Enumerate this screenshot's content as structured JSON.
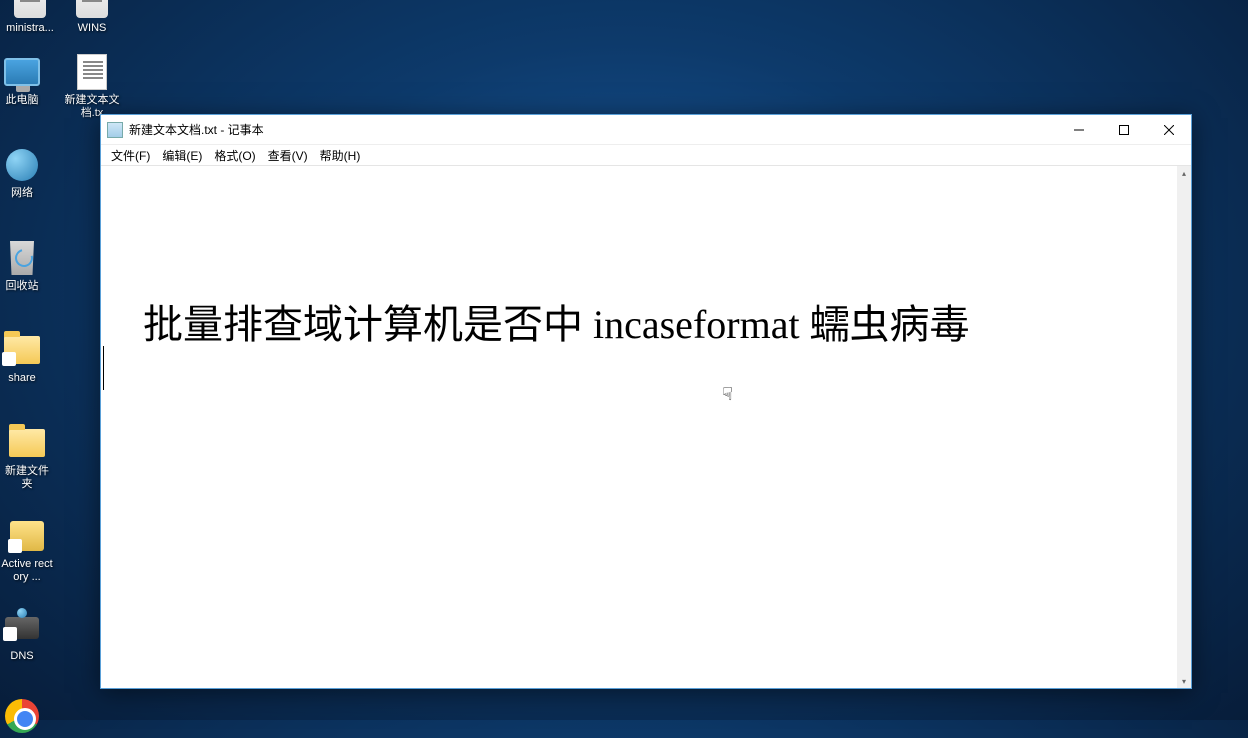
{
  "desktop": {
    "icons": [
      {
        "label": "ministra...",
        "kind": "admin"
      },
      {
        "label": "WINS",
        "kind": "wins"
      },
      {
        "label": "此电脑",
        "kind": "pc"
      },
      {
        "label": "新建文本文档.tx",
        "kind": "txt"
      },
      {
        "label": "网络",
        "kind": "network"
      },
      {
        "label": "回收站",
        "kind": "recycle"
      },
      {
        "label": "share",
        "kind": "folder-share"
      },
      {
        "label": "新建文件夹",
        "kind": "folder"
      },
      {
        "label": "Active rectory ...",
        "kind": "adtool"
      },
      {
        "label": "DNS",
        "kind": "dns"
      },
      {
        "label": "",
        "kind": "chrome"
      }
    ]
  },
  "window": {
    "title": "新建文本文档.txt - 记事本",
    "menu": [
      "文件(F)",
      "编辑(E)",
      "格式(O)",
      "查看(V)",
      "帮助(H)"
    ],
    "controls": {
      "minimize": "minimize",
      "maximize": "maximize",
      "close": "close"
    },
    "content": "批量排查域计算机是否中 incaseformat 蠕虫病毒"
  }
}
